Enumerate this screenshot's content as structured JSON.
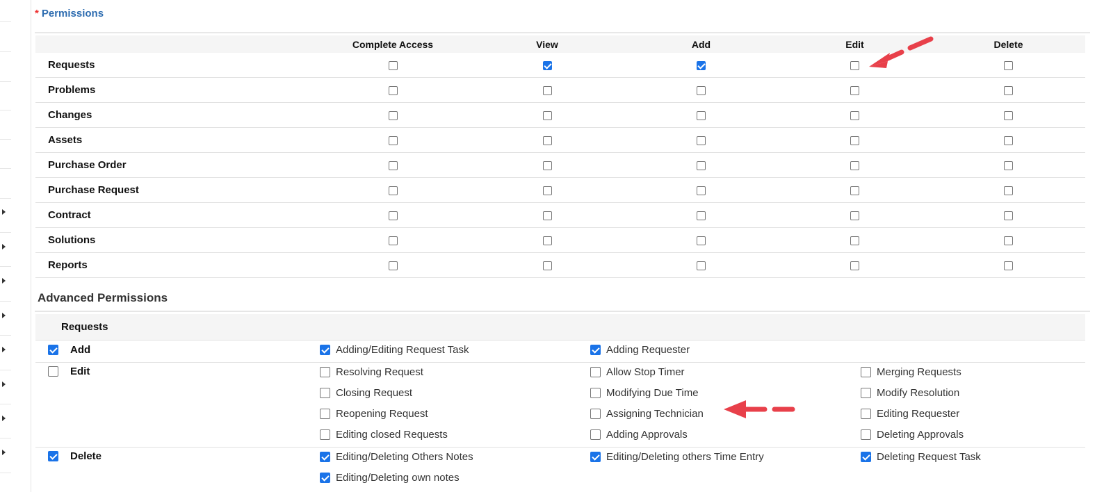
{
  "permissions": {
    "required_marker": "*",
    "title": "Permissions",
    "columns": [
      "Complete Access",
      "View",
      "Add",
      "Edit",
      "Delete"
    ],
    "rows": [
      {
        "module": "Requests",
        "checks": [
          false,
          true,
          true,
          false,
          false
        ]
      },
      {
        "module": "Problems",
        "checks": [
          false,
          false,
          false,
          false,
          false
        ]
      },
      {
        "module": "Changes",
        "checks": [
          false,
          false,
          false,
          false,
          false
        ]
      },
      {
        "module": "Assets",
        "checks": [
          false,
          false,
          false,
          false,
          false
        ]
      },
      {
        "module": "Purchase Order",
        "checks": [
          false,
          false,
          false,
          false,
          false
        ]
      },
      {
        "module": "Purchase Request",
        "checks": [
          false,
          false,
          false,
          false,
          false
        ]
      },
      {
        "module": "Contract",
        "checks": [
          false,
          false,
          false,
          false,
          false
        ]
      },
      {
        "module": "Solutions",
        "checks": [
          false,
          false,
          false,
          false,
          false
        ]
      },
      {
        "module": "Reports",
        "checks": [
          false,
          false,
          false,
          false,
          false
        ]
      }
    ]
  },
  "advanced": {
    "title": "Advanced Permissions",
    "module": "Requests",
    "ops": [
      {
        "label": "Add",
        "checked": true,
        "subs": [
          {
            "label": "Adding/Editing Request Task",
            "checked": true
          },
          {
            "label": "Adding Requester",
            "checked": true
          }
        ]
      },
      {
        "label": "Edit",
        "checked": false,
        "subs": [
          {
            "label": "Resolving Request",
            "checked": false
          },
          {
            "label": "Allow Stop Timer",
            "checked": false
          },
          {
            "label": "Merging Requests",
            "checked": false
          },
          {
            "label": "Closing Request",
            "checked": false
          },
          {
            "label": "Modifying Due Time",
            "checked": false
          },
          {
            "label": "Modify Resolution",
            "checked": false
          },
          {
            "label": "Reopening Request",
            "checked": false
          },
          {
            "label": "Assigning Technician",
            "checked": false
          },
          {
            "label": "Editing Requester",
            "checked": false
          },
          {
            "label": "Editing closed Requests",
            "checked": false
          },
          {
            "label": "Adding Approvals",
            "checked": false
          },
          {
            "label": "Deleting Approvals",
            "checked": false
          }
        ]
      },
      {
        "label": "Delete",
        "checked": true,
        "subs": [
          {
            "label": "Editing/Deleting Others Notes",
            "checked": true
          },
          {
            "label": "Editing/Deleting others Time Entry",
            "checked": true
          },
          {
            "label": "Deleting Request Task",
            "checked": true
          },
          {
            "label": "Editing/Deleting own notes",
            "checked": true
          }
        ]
      }
    ]
  },
  "colors": {
    "accent": "#1a73e8",
    "title_blue": "#2d6cb0",
    "annotation_red": "#e8404a"
  }
}
